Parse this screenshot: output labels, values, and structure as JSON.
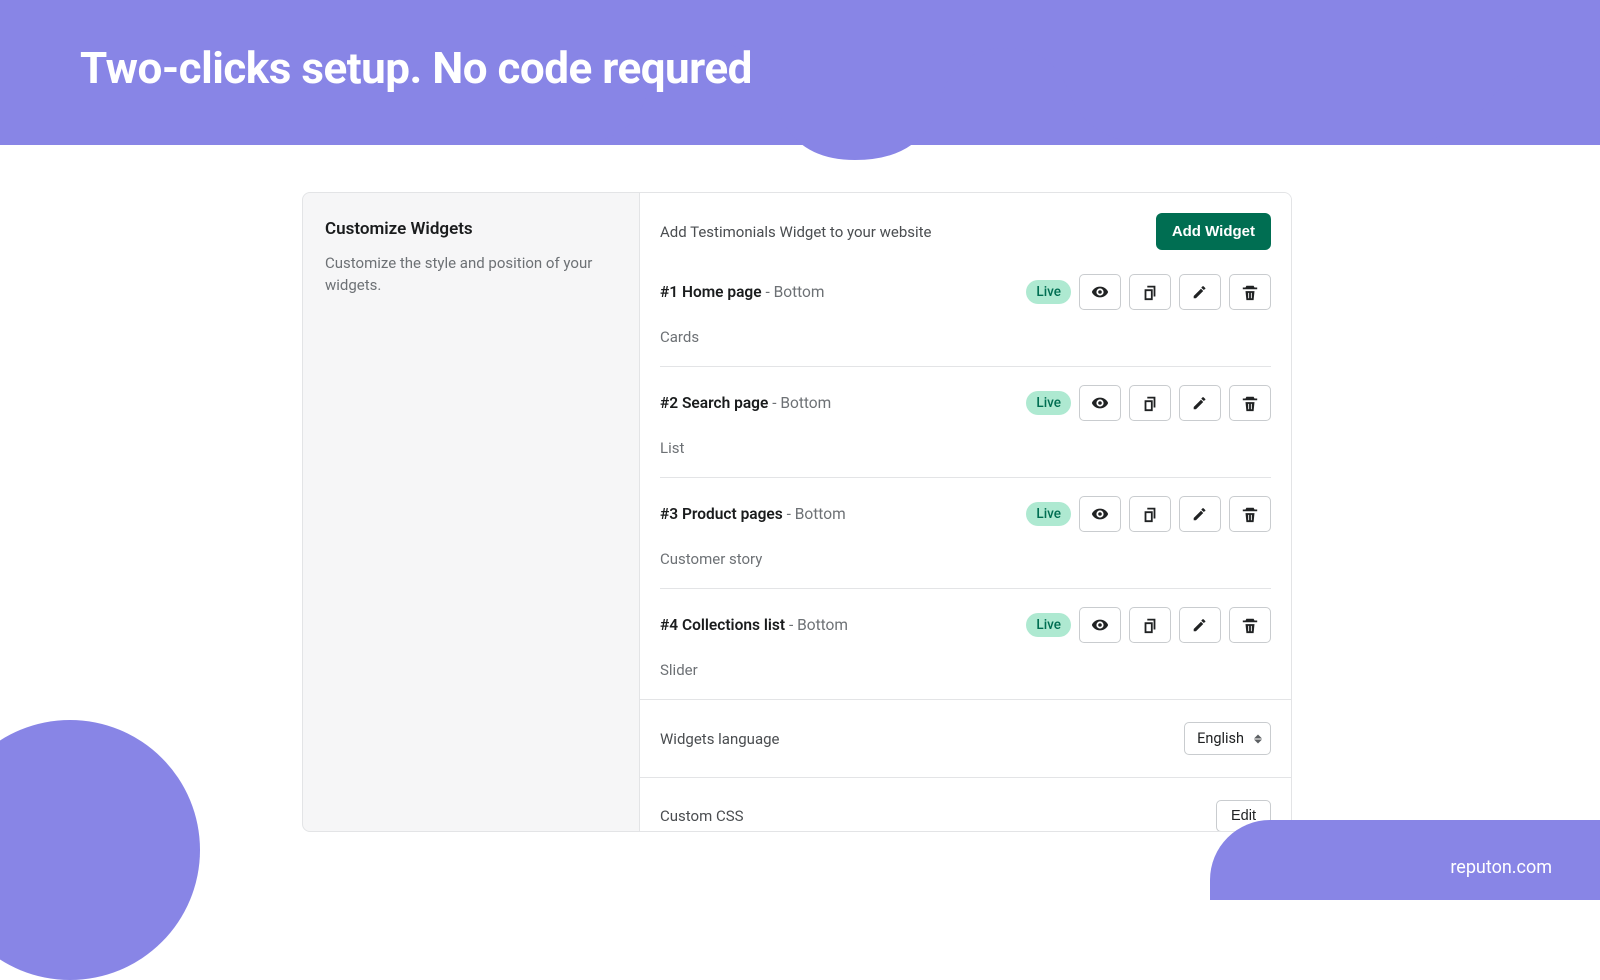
{
  "hero": {
    "title": "Two-clicks setup. No code requred"
  },
  "brand": "reputon.com",
  "sidebar": {
    "title": "Customize Widgets",
    "desc": "Customize the style and position of your widgets."
  },
  "panel": {
    "lead": "Add Testimonials Widget to your website",
    "add_button": "Add Widget",
    "live_label": "Live",
    "widgets": [
      {
        "index": "#1",
        "name": "Home page",
        "position": "Bottom",
        "type": "Cards"
      },
      {
        "index": "#2",
        "name": "Search page",
        "position": "Bottom",
        "type": "List"
      },
      {
        "index": "#3",
        "name": "Product pages",
        "position": "Bottom",
        "type": "Customer story"
      },
      {
        "index": "#4",
        "name": "Collections list",
        "position": "Bottom",
        "type": "Slider"
      }
    ],
    "language_label": "Widgets language",
    "language_value": "English",
    "css_label": "Custom CSS",
    "css_button": "Edit"
  }
}
